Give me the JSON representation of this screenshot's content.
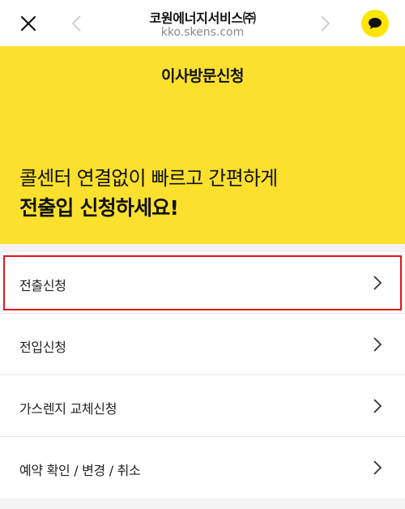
{
  "browser": {
    "title": "코원에너지서비스㈜",
    "url": "kko.skens.com",
    "icons": {
      "close": "close-icon",
      "back": "chevron-left-icon",
      "forward": "chevron-right-icon",
      "chat": "kakao-chat-icon"
    },
    "chat_color": "#fee500"
  },
  "hero": {
    "title": "이사방문신청",
    "line1": "콜센터 연결없이 빠르고 간편하게",
    "line2": "전출입 신청하세요!",
    "bg_color": "#fbe12d"
  },
  "menu": {
    "items": [
      {
        "label": "전출신청",
        "selected": true
      },
      {
        "label": "전입신청",
        "selected": false
      },
      {
        "label": "가스렌지 교체신청",
        "selected": false
      },
      {
        "label": "예약 확인 / 변경 / 취소",
        "selected": false
      }
    ],
    "selection_color": "#e0141a"
  }
}
